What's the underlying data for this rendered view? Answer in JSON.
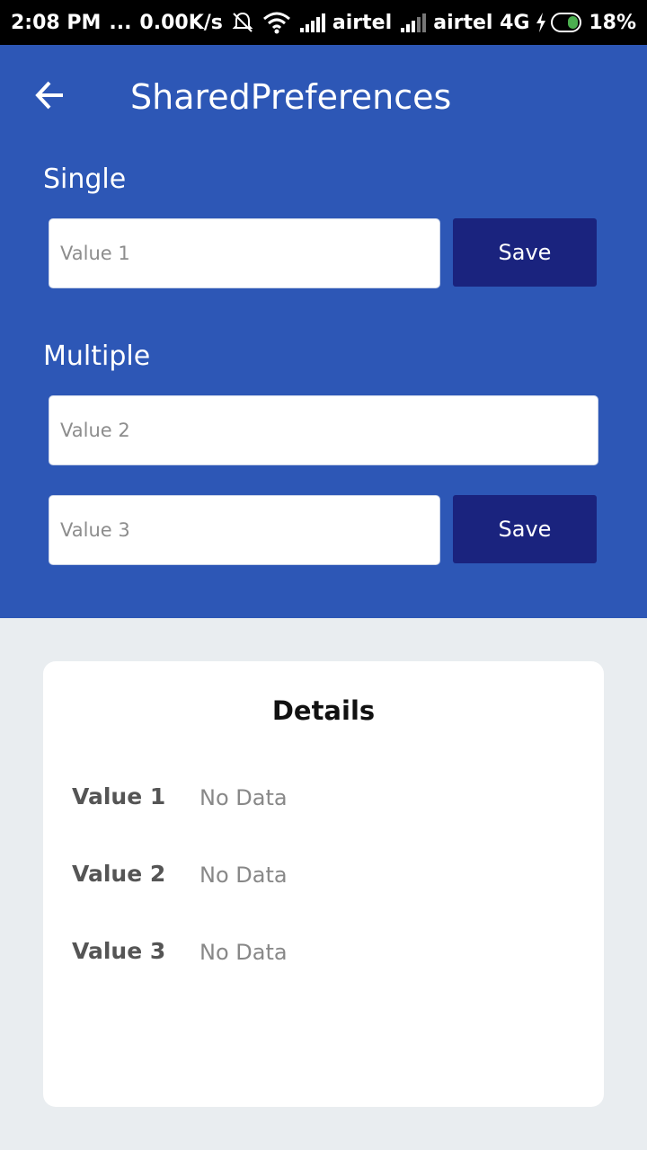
{
  "status_bar": {
    "time": "2:08 PM",
    "dots": "...",
    "speed": "0.00K/s",
    "carrier1": "airtel",
    "carrier2": "airtel 4G",
    "battery": "18%"
  },
  "toolbar": {
    "back_icon": "arrow-back-icon",
    "title": "SharedPreferences"
  },
  "single": {
    "label": "Single",
    "input1": {
      "placeholder": "Value 1",
      "value": ""
    },
    "save_label": "Save"
  },
  "multiple": {
    "label": "Multiple",
    "input2": {
      "placeholder": "Value 2",
      "value": ""
    },
    "input3": {
      "placeholder": "Value 3",
      "value": ""
    },
    "save_label": "Save"
  },
  "details": {
    "title": "Details",
    "rows": [
      {
        "label": "Value 1",
        "value": "No Data"
      },
      {
        "label": "Value 2",
        "value": "No Data"
      },
      {
        "label": "Value 3",
        "value": "No Data"
      }
    ]
  },
  "colors": {
    "primary": "#2d57b6",
    "button": "#1a237e",
    "background": "#e9edf0"
  }
}
